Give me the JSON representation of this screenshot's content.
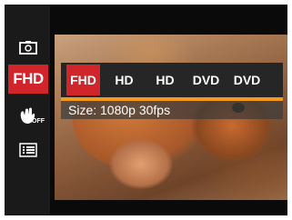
{
  "sidebar": {
    "items": [
      {
        "name": "image-stabilizer-icon"
      },
      {
        "name": "resolution",
        "label": "FHD",
        "selected": true
      },
      {
        "name": "shake-reduction-off-icon",
        "badge": "OFF"
      },
      {
        "name": "menu-list-icon"
      }
    ]
  },
  "options": [
    {
      "label": "FHD",
      "selected": true
    },
    {
      "label": "HD"
    },
    {
      "label": "HD"
    },
    {
      "label": "DVD"
    },
    {
      "label": "DVD"
    }
  ],
  "info": {
    "text": "Size: 1080p 30fps"
  },
  "colors": {
    "selected": "#d0262b",
    "accent": "#f39a1c",
    "bar": "#262626"
  }
}
